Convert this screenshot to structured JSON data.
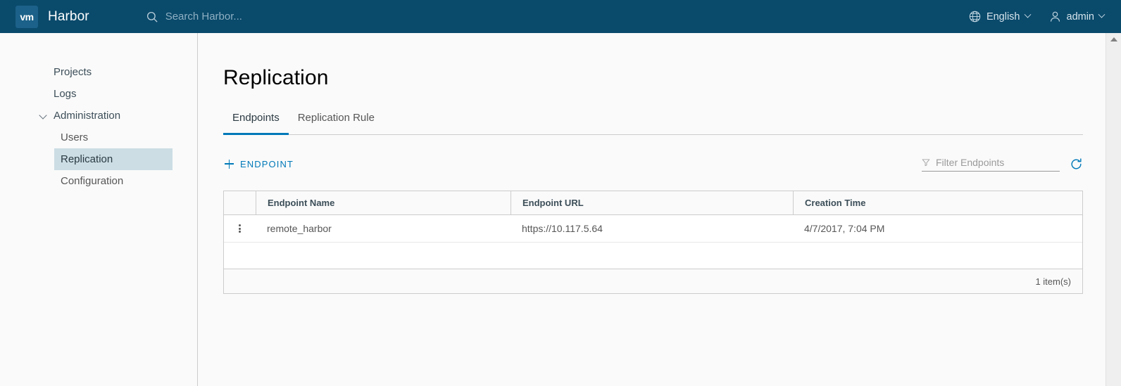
{
  "header": {
    "logo_text": "vm",
    "brand_title": "Harbor",
    "search_placeholder": "Search Harbor...",
    "search_value": "",
    "language": "English",
    "user": "admin",
    "background_color": "#0a4a6b"
  },
  "sidebar": {
    "items": [
      {
        "label": "Projects",
        "type": "top",
        "active": false
      },
      {
        "label": "Logs",
        "type": "top",
        "active": false
      },
      {
        "label": "Administration",
        "type": "group",
        "active": false
      },
      {
        "label": "Users",
        "type": "sub",
        "active": false
      },
      {
        "label": "Replication",
        "type": "sub",
        "active": true
      },
      {
        "label": "Configuration",
        "type": "sub",
        "active": false
      }
    ]
  },
  "main": {
    "page_title": "Replication",
    "tabs": [
      {
        "label": "Endpoints",
        "active": true
      },
      {
        "label": "Replication Rule",
        "active": false
      }
    ],
    "actions": {
      "add_endpoint_label": "ENDPOINT",
      "filter_placeholder": "Filter Endpoints",
      "filter_value": "",
      "refresh_icon": "refresh-icon",
      "filter_icon": "funnel-icon",
      "accent_color": "#0079b8"
    },
    "table": {
      "columns": [
        "Endpoint Name",
        "Endpoint URL",
        "Creation Time"
      ],
      "rows": [
        {
          "name": "remote_harbor",
          "url": "https://10.117.5.64",
          "creation_time": "4/7/2017, 7:04 PM"
        }
      ],
      "footer_text": "1 item(s)"
    }
  }
}
